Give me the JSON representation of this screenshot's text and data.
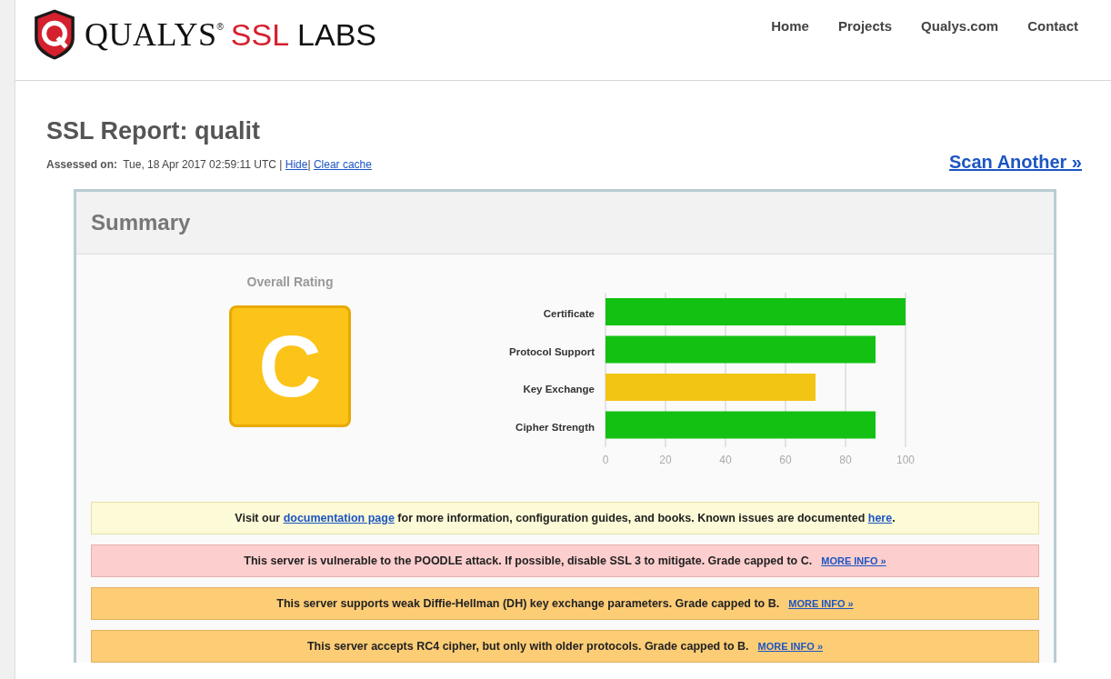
{
  "logo": {
    "brand": "QUALYS",
    "mark": "®",
    "accent": "SSL",
    "tail": "LABS"
  },
  "nav": [
    {
      "label": "Home"
    },
    {
      "label": "Projects"
    },
    {
      "label": "Qualys.com"
    },
    {
      "label": "Contact"
    }
  ],
  "report": {
    "title": "SSL Report: qualit",
    "assessed_label": "Assessed on:",
    "assessed_value": "Tue, 18 Apr 2017 02:59:11 UTC",
    "separator": "|",
    "links": [
      "Hide",
      "Clear cache"
    ],
    "scan_another": "Scan Another »"
  },
  "summary": {
    "title": "Summary",
    "rating_label": "Overall Rating",
    "grade": "C",
    "chart_data": {
      "type": "bar",
      "orientation": "horizontal",
      "grid": true,
      "categories": [
        "Certificate",
        "Protocol Support",
        "Key Exchange",
        "Cipher Strength"
      ],
      "xlim": [
        0,
        100
      ],
      "xticks": [
        0,
        20,
        40,
        60,
        80,
        100
      ],
      "series": [
        {
          "color": "#13c113",
          "values": [
            100,
            90,
            null,
            90
          ]
        },
        {
          "color": "#f2c514",
          "values": [
            null,
            null,
            70,
            null
          ]
        }
      ]
    }
  },
  "notices": [
    {
      "kind": "info",
      "parts": [
        {
          "text": "Visit our "
        },
        {
          "text": "documentation page",
          "link": true
        },
        {
          "text": " for more information, configuration guides, and books. Known issues are documented "
        },
        {
          "text": "here",
          "link": true
        },
        {
          "text": "."
        }
      ]
    },
    {
      "kind": "error",
      "parts": [
        {
          "text": "This server is vulnerable to the POODLE attack. If possible, disable SSL 3 to mitigate. Grade capped to C."
        }
      ],
      "more": "MORE INFO »"
    },
    {
      "kind": "warning",
      "parts": [
        {
          "text": "This server supports weak Diffie-Hellman (DH) key exchange parameters. Grade capped to B."
        }
      ],
      "more": "MORE INFO »"
    },
    {
      "kind": "warning",
      "parts": [
        {
          "text": "This server accepts RC4 cipher, but only with older protocols. Grade capped to B."
        }
      ],
      "more": "MORE INFO »"
    }
  ]
}
